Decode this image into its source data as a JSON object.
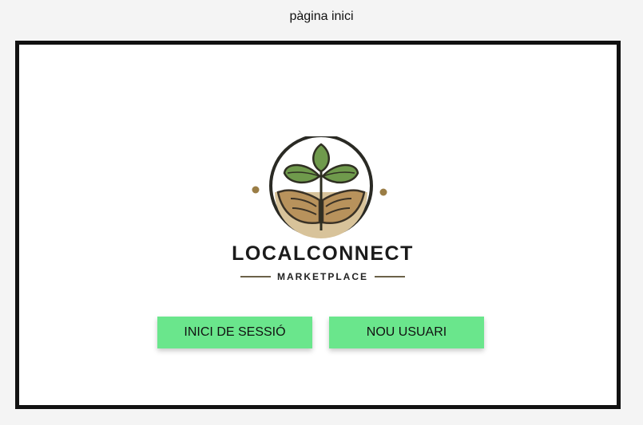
{
  "page": {
    "title": "pàgina inici"
  },
  "logo": {
    "name": "LOCALCONNECT",
    "subtitle": "MARKETPLACE",
    "icon": "leaf-hands-icon",
    "colors": {
      "leaf": "#6f9a4c",
      "leaf_dark": "#3f5f2c",
      "hands": "#bfa06c",
      "outline": "#2a2a24"
    }
  },
  "buttons": {
    "login_label": "INICI DE SESSIÓ",
    "new_user_label": "NOU USUARI"
  },
  "colors": {
    "button": "#6ae68c",
    "frame_border": "#111111",
    "background": "#f4f4f4"
  }
}
